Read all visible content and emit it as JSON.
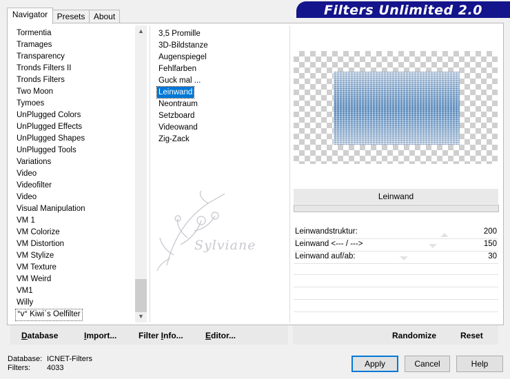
{
  "banner": {
    "title": "Filters Unlimited 2.0"
  },
  "tabs": [
    {
      "label": "Navigator",
      "active": true
    },
    {
      "label": "Presets",
      "active": false
    },
    {
      "label": "About",
      "active": false
    }
  ],
  "categories": [
    "Tormentia",
    "Tramages",
    "Transparency",
    "Tronds Filters II",
    "Tronds Filters",
    "Two Moon",
    "Tymoes",
    "UnPlugged Colors",
    "UnPlugged Effects",
    "UnPlugged Shapes",
    "UnPlugged Tools",
    "Variations",
    "Video",
    "Videofilter",
    "Video",
    "Visual Manipulation",
    "VM 1",
    "VM Colorize",
    "VM Distortion",
    "VM Stylize",
    "VM Texture",
    "VM Weird",
    "VM1",
    "Willy",
    "°v° Kiwi`s Oelfilter"
  ],
  "filters": [
    {
      "label": "3,5 Promille",
      "selected": false
    },
    {
      "label": "3D-Bildstanze",
      "selected": false
    },
    {
      "label": "Augenspiegel",
      "selected": false
    },
    {
      "label": "Fehlfarben",
      "selected": false
    },
    {
      "label": "Guck mal ...",
      "selected": false
    },
    {
      "label": "Leinwand",
      "selected": true
    },
    {
      "label": "Neontraum",
      "selected": false
    },
    {
      "label": "Setzboard",
      "selected": false
    },
    {
      "label": "Videowand",
      "selected": false
    },
    {
      "label": "Zig-Zack",
      "selected": false
    }
  ],
  "watermark": {
    "text": "Sylviane"
  },
  "filter_name": "Leinwand",
  "parameters": [
    {
      "label": "Leinwandstruktur:",
      "value": "200",
      "fraction": 0.78
    },
    {
      "label": "Leinwand <--- / --->",
      "value": "150",
      "fraction": 0.59
    },
    {
      "label": "Leinwand auf/ab:",
      "value": "30",
      "fraction": 0.12
    }
  ],
  "toolbar_left": {
    "database": {
      "underlined": "D",
      "rest": "atabase"
    },
    "import": {
      "underlined": "I",
      "rest": "mport..."
    },
    "filter_info": {
      "prefix": "Filter ",
      "underlined": "I",
      "rest": "nfo..."
    },
    "editor": {
      "underlined": "E",
      "rest": "ditor..."
    }
  },
  "toolbar_right": {
    "randomize": "Randomize",
    "reset": "Reset"
  },
  "status": {
    "database_label": "Database:",
    "database_value": "ICNET-Filters",
    "filters_label": "Filters:",
    "filters_value": "4033"
  },
  "buttons": {
    "apply": "Apply",
    "cancel": "Cancel",
    "help": "Help"
  },
  "colors": {
    "banner": "#14148c",
    "selection": "#0078d7"
  }
}
